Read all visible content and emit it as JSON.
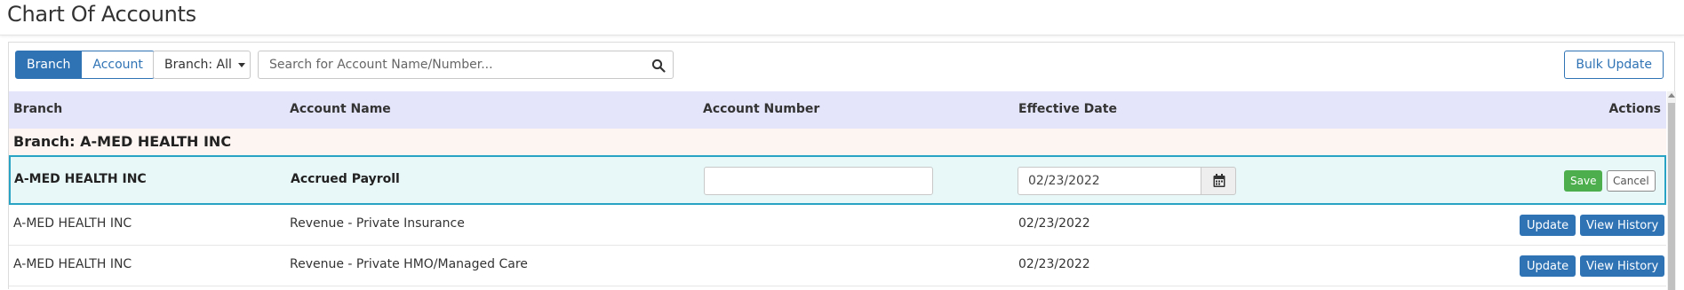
{
  "page": {
    "title": "Chart Of Accounts"
  },
  "toolbar": {
    "view_toggle": [
      {
        "label": "Branch",
        "active": true
      },
      {
        "label": "Account",
        "active": false
      }
    ],
    "branch_filter": "Branch: All",
    "search_placeholder": "Search for Account Name/Number...",
    "search_value": "",
    "bulk_update_label": "Bulk Update"
  },
  "table": {
    "columns": [
      "Branch",
      "Account Name",
      "Account Number",
      "Effective Date",
      "Actions"
    ],
    "group_label": "Branch: A-MED HEALTH INC",
    "edit_row": {
      "branch": "A-MED HEALTH INC",
      "account_name": "Accrued Payroll",
      "account_number": "",
      "effective_date": "02/23/2022",
      "save_label": "Save",
      "cancel_label": "Cancel"
    },
    "rows": [
      {
        "branch": "A-MED HEALTH INC",
        "account_name": "Revenue - Private Insurance",
        "account_number": "",
        "effective_date": "02/23/2022",
        "update_label": "Update",
        "history_label": "View History"
      },
      {
        "branch": "A-MED HEALTH INC",
        "account_name": "Revenue - Private HMO/Managed Care",
        "account_number": "",
        "effective_date": "02/23/2022",
        "update_label": "Update",
        "history_label": "View History"
      }
    ]
  },
  "icons": {
    "search": "search-icon",
    "calendar": "calendar-icon",
    "caret": "chevron-down-icon"
  },
  "colors": {
    "primary": "#2f73b5",
    "success": "#4cae4c",
    "header_bg": "#e4e4fb",
    "group_bg": "#fdf5f1",
    "edit_bg": "#e8f7f8",
    "edit_border": "#28a3c4"
  }
}
